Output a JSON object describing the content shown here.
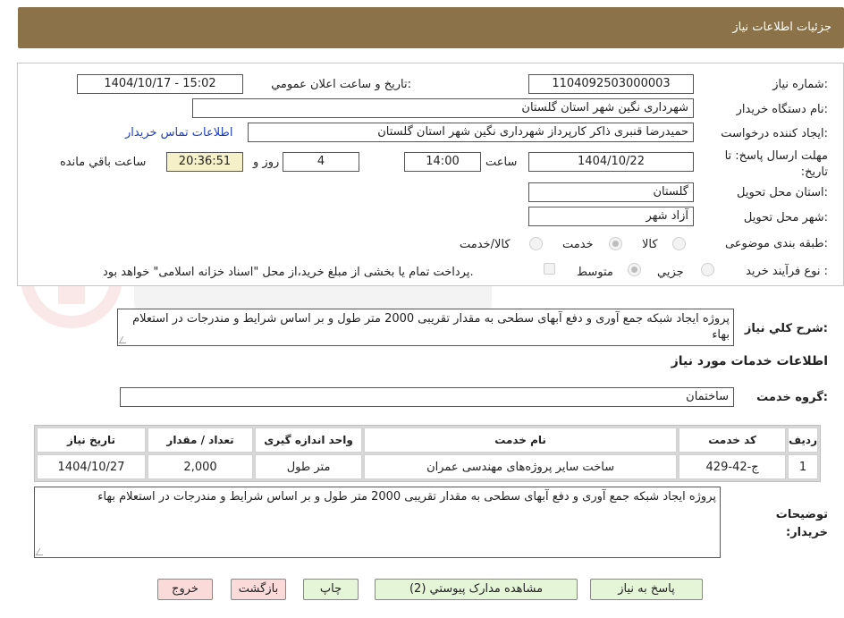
{
  "header": {
    "title": "جزئیات اطلاعات نیاز"
  },
  "fields": {
    "need_number_label": "شماره نیاز:",
    "need_number": "1104092503000003",
    "announce_label": "تاریخ و ساعت اعلان عمومي:",
    "announce_value": "1404/10/17 - 15:02",
    "buyer_org_label": "نام دستگاه خريدار:",
    "buyer_org": "شهرداری نگین شهر استان گلستان",
    "creator_label": "ايجاد كننده درخواست:",
    "creator": "حمیدرضا قنبری ذاکر کارپرداز شهرداری نگین شهر استان گلستان",
    "contact_link": "اطلاعات تماس خريدار",
    "deadline_label": "مهلت ارسال پاسخ: تا تاريخ:",
    "deadline_date": "1404/10/22",
    "time_label": "ساعت",
    "deadline_time": "14:00",
    "days_value": "4",
    "days_label": "روز و",
    "remaining_time": "20:36:51",
    "remaining_label": "ساعت باقي مانده",
    "province_label": "استان محل تحویل:",
    "province": "گلستان",
    "city_label": "شهر محل تحویل:",
    "city": "آزاد شهر",
    "category_label": "طبقه بندی موضوعی:",
    "category_options": [
      "کالا",
      "خدمت",
      "کالا/خدمت"
    ],
    "process_label": "نوع فرآیند خرید :",
    "process_options": [
      "جزيي",
      "متوسط"
    ],
    "payment_note": "پرداخت تمام یا بخشی از مبلغ خرید،از محل \"اسناد خزانه اسلامی\" خواهد بود."
  },
  "summary": {
    "label": "شرح کلي نياز:",
    "text": "پروژه ایجاد شبکه جمع آوری و دفع آبهای سطحی به مقدار تقریبی 2000 متر طول و بر اساس شرایط و مندرجات در استعلام بهاء"
  },
  "services_section": {
    "title": "اطلاعات خدمات مورد نياز",
    "group_label": "گروه خدمت:",
    "group_value": "ساختمان"
  },
  "table": {
    "headers": [
      "رديف",
      "کد خدمت",
      "نام خدمت",
      "واحد اندازه گيری",
      "تعداد / مقدار",
      "تاريخ نياز"
    ],
    "rows": [
      [
        "1",
        "ج-42-429",
        "ساخت سایر پروژه‌های مهندسی عمران",
        "متر طول",
        "2,000",
        "1404/10/27"
      ]
    ]
  },
  "buyer_notes": {
    "label": "توضيحات خريدار:",
    "text": "پروژه ایجاد شبکه جمع آوری و دفع آبهای سطحی به مقدار تقریبی 2000 متر طول و بر اساس شرایط و مندرجات در استعلام بهاء"
  },
  "buttons": {
    "reply": "پاسخ به نياز",
    "attachments": "مشاهده مدارک پيوستي (2)",
    "print": "چاپ",
    "back": "بازگشت",
    "exit": "خروج"
  },
  "colors": {
    "header_bg": "#8b7248",
    "green_button": "#e5f5d8",
    "pink_button": "#fbdada",
    "remaining_bg": "#f5f0c8"
  }
}
